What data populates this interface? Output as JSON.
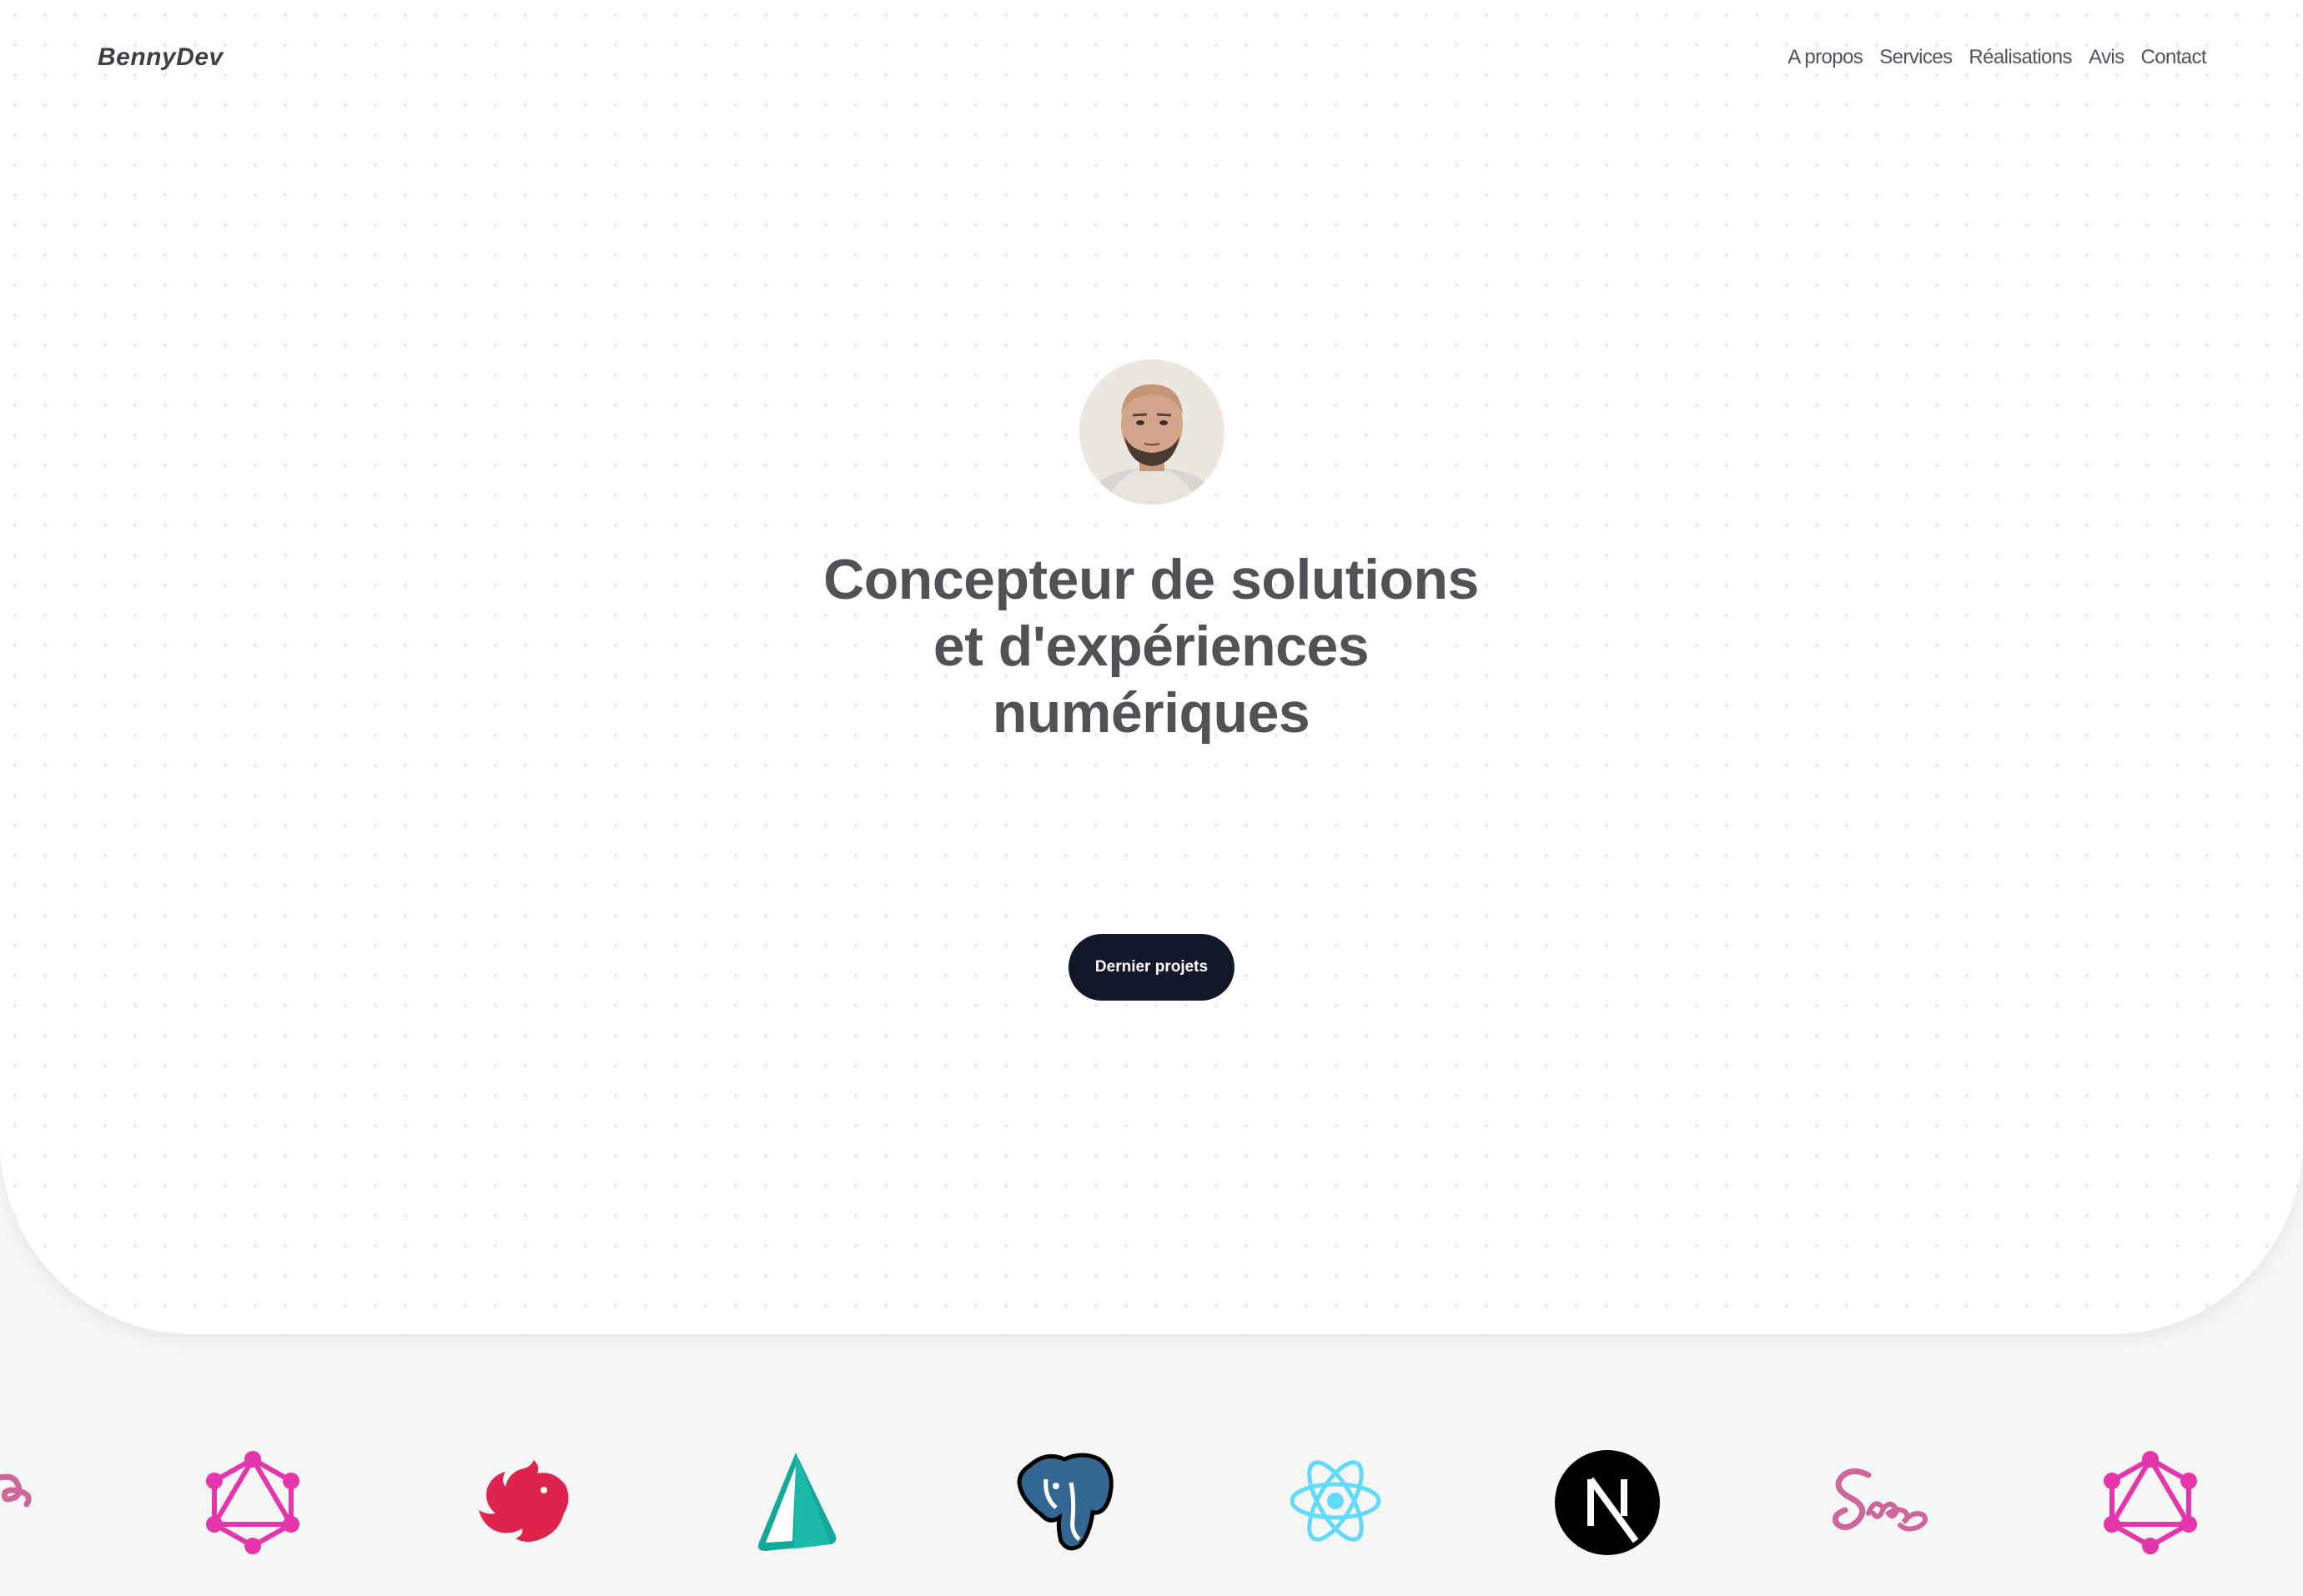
{
  "header": {
    "brand": "BennyDev",
    "nav": [
      "A propos",
      "Services",
      "Réalisations",
      "Avis",
      "Contact"
    ]
  },
  "hero": {
    "title_lines": [
      "Concepteur de solutions",
      "et d'expériences",
      "numériques"
    ],
    "cta_label": "Dernier projets"
  },
  "tech_logos": [
    {
      "icon": "sass-logo-partial"
    },
    {
      "icon": "graphql-logo",
      "color": "#E535AB"
    },
    {
      "icon": "nestjs-logo",
      "color": "#E0234E"
    },
    {
      "icon": "prisma-logo",
      "color": "#14A89B"
    },
    {
      "icon": "postgresql-logo",
      "color": "#336791"
    },
    {
      "icon": "react-logo",
      "color": "#61DAFB"
    },
    {
      "icon": "nextjs-logo",
      "color": "#000000"
    },
    {
      "icon": "sass-logo",
      "color": "#CD6799"
    },
    {
      "icon": "graphql-logo",
      "color": "#E535AB"
    }
  ],
  "colors": {
    "cta_background": "#111827",
    "headline": "#525256",
    "page_background": "#f6f6f7"
  }
}
